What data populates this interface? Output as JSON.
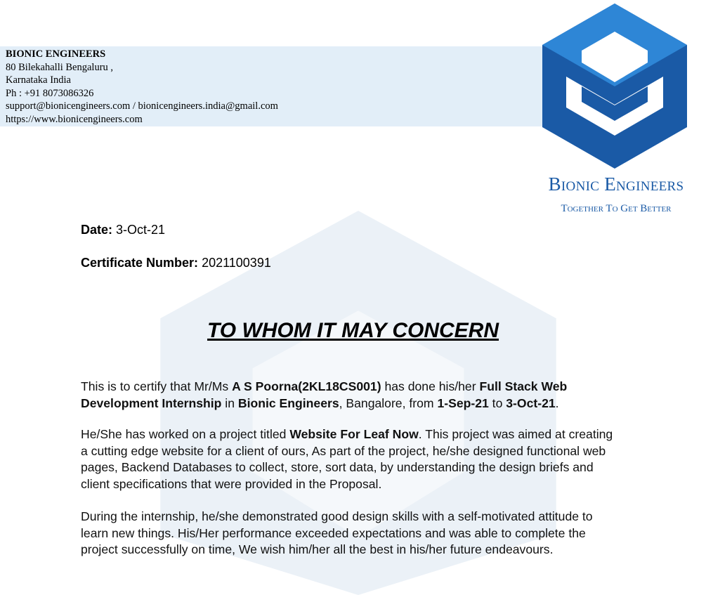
{
  "header": {
    "company_name": "BIONIC ENGINEERS",
    "address_line1": "80 Bilekahalli Bengaluru ,",
    "address_line2": "Karnataka India",
    "phone": "Ph : +91 8073086326",
    "emails": "support@bionicengineers.com /  bionicengineers.india@gmail.com",
    "website": "https://www.bionicengineers.com"
  },
  "logo": {
    "brand_name": "Bionic Engineers",
    "tagline": "Together To Get Better",
    "color": "#1a5aa6",
    "icon": "cube-logo-icon"
  },
  "meta": {
    "date_label": "Date:",
    "date_value": "3-Oct-21",
    "cert_label": "Certificate Number:",
    "cert_value": "2021100391"
  },
  "heading": "TO WHOM IT MAY CONCERN",
  "para1": {
    "t1": "This is to certify that Mr/Ms ",
    "name": "A S Poorna(2KL18CS001)",
    "t2": " has done his/her ",
    "program": "Full Stack Web Development Internship",
    "t3": " in ",
    "company": "Bionic Engineers",
    "t4": ", Bangalore, from ",
    "start": "1-Sep-21",
    "t5": " to ",
    "end": "3-Oct-21",
    "t6": "."
  },
  "para2": {
    "t1": "He/She has worked on a project titled ",
    "project": "Website For Leaf Now",
    "t2": ". This project was aimed at creating a cutting edge website for a client of ours, As part of the project, he/she designed functional web pages, Backend Databases to collect, store, sort data, by understanding the design briefs and client specifications that were provided in the Proposal."
  },
  "para3": "During the internship, he/she demonstrated good design skills with a self-motivated attitude to learn new things. His/Her performance exceeded expectations and was able to complete the project successfully on time, We wish him/her all the best in his/her future endeavours."
}
